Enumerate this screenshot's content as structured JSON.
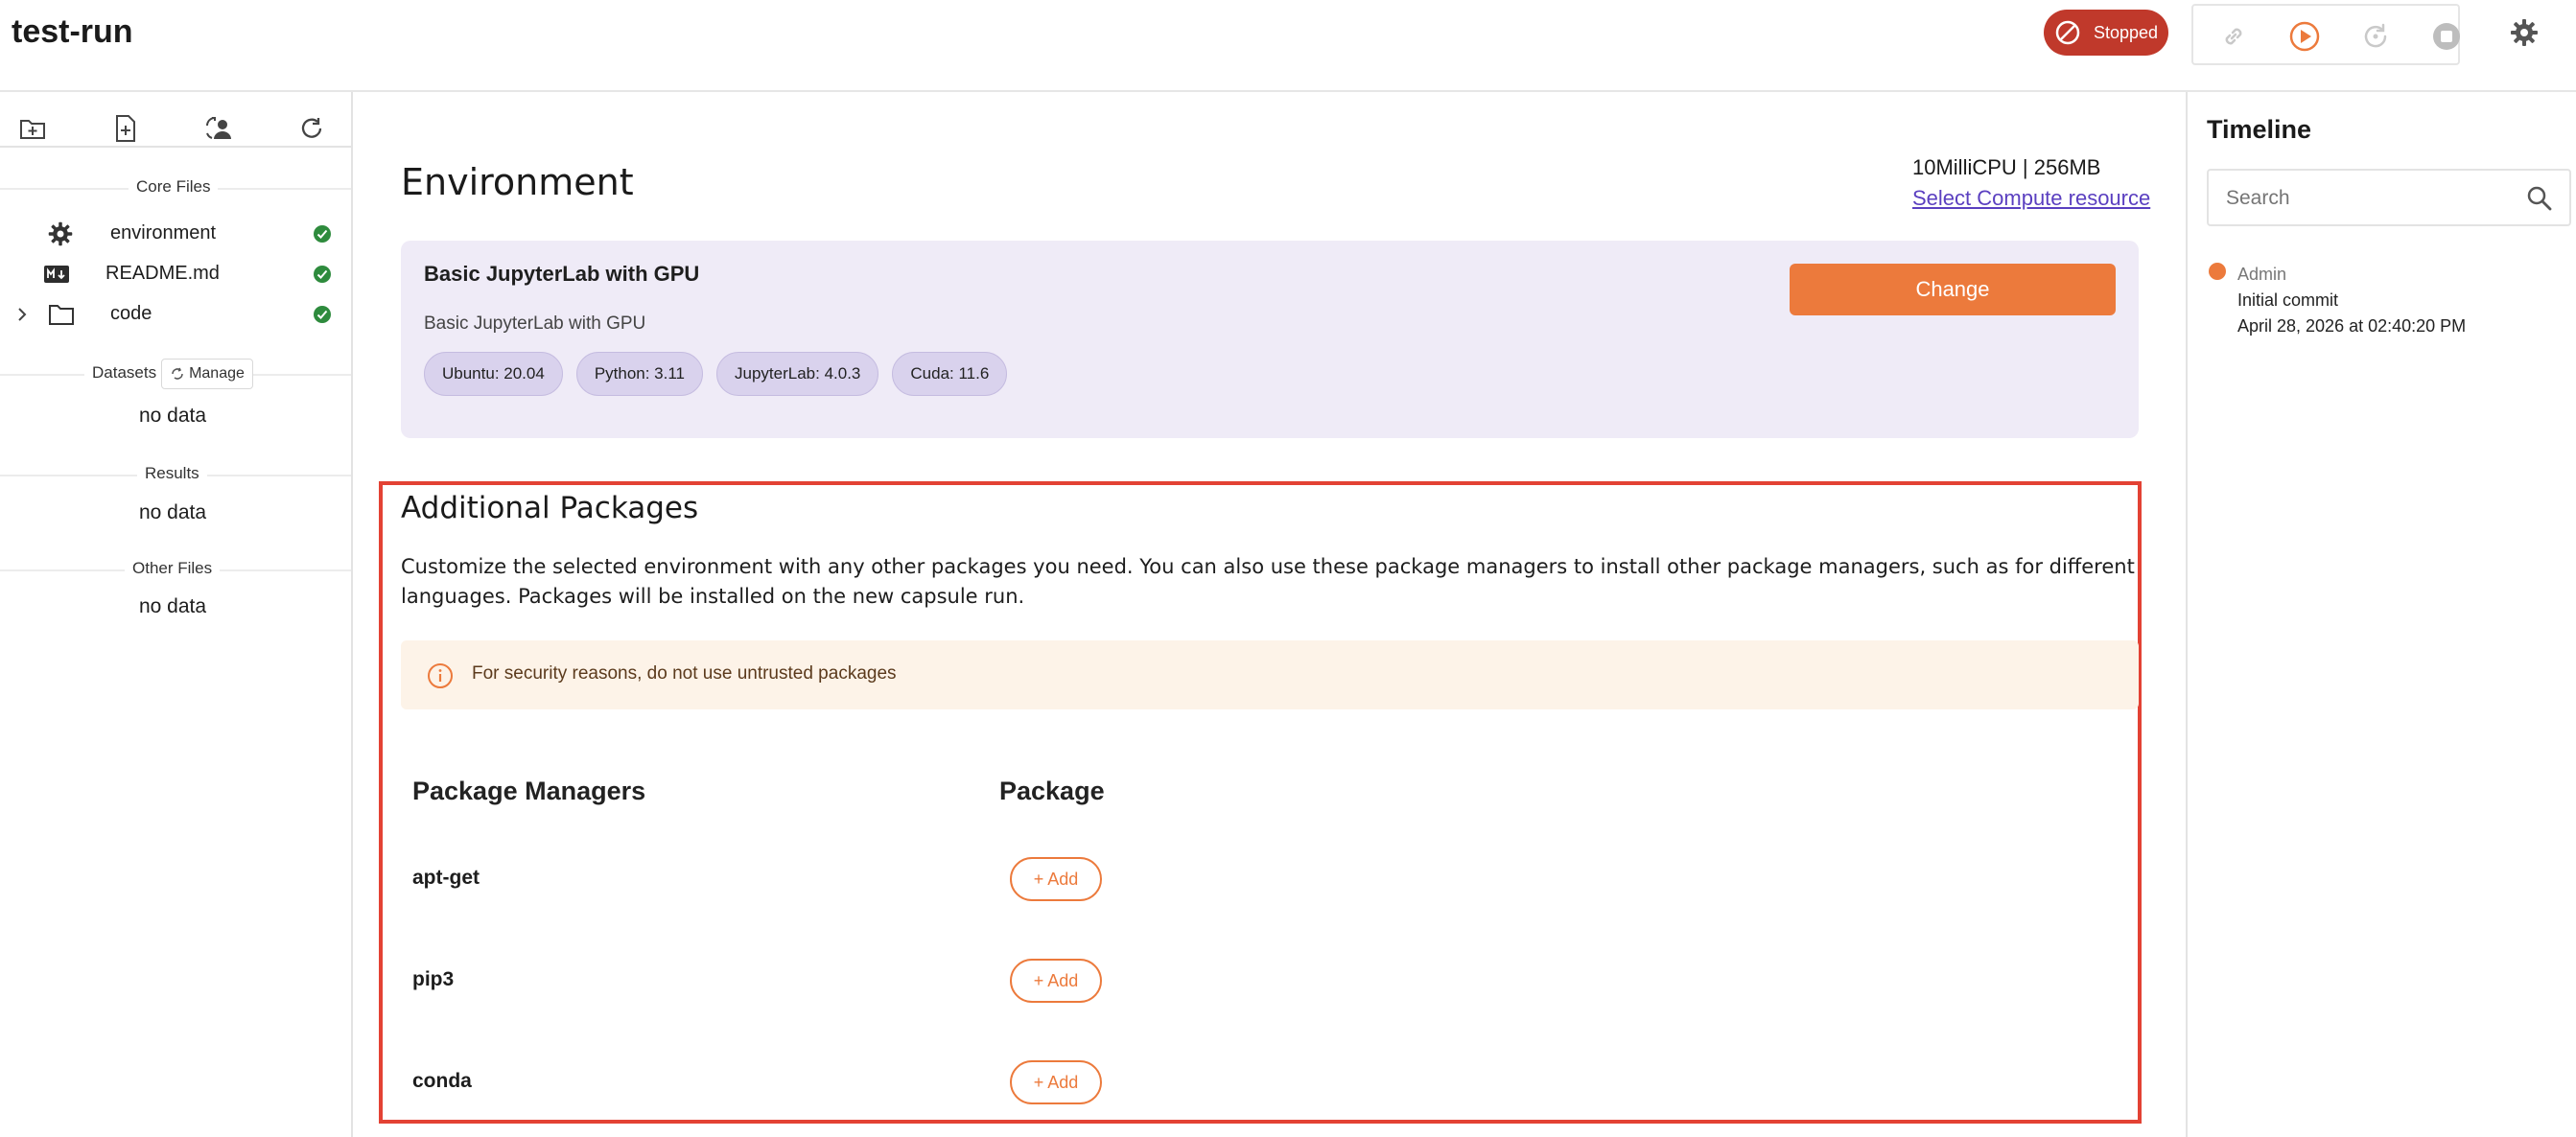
{
  "app": {
    "title": "test-run"
  },
  "header": {
    "status": "Stopped",
    "colors": {
      "status_bg": "#c0392b",
      "accent": "#ec7a3c"
    },
    "tools": [
      "link-icon",
      "play-icon",
      "restart-icon",
      "stop-icon"
    ],
    "settings_icon": "gear-icon"
  },
  "sidebar": {
    "tools": [
      "new-folder-icon",
      "new-file-icon",
      "switch-user-icon",
      "refresh-icon"
    ],
    "core_files_label": "Core Files",
    "files": [
      {
        "name": "environment",
        "icon": "gear-icon",
        "status": "check-icon"
      },
      {
        "name": "README.md",
        "icon": "markdown-icon",
        "status": "check-icon"
      },
      {
        "name": "code",
        "icon": "folder-icon",
        "status": "check-icon"
      }
    ],
    "datasets_label": "Datasets",
    "manage_label": "Manage",
    "datasets_empty": "no data",
    "results_label": "Results",
    "results_empty": "no data",
    "other_files_label": "Other Files",
    "other_files_empty": "no data"
  },
  "main": {
    "title": "Environment",
    "compute": "10MilliCPU | 256MB",
    "compute_link": "Select Compute resource",
    "env": {
      "name": "Basic JupyterLab with GPU",
      "description": "Basic JupyterLab with GPU",
      "tags": [
        "Ubuntu: 20.04",
        "Python: 3.11",
        "JupyterLab: 4.0.3",
        "Cuda: 11.6"
      ],
      "change_label": "Change"
    },
    "additional": {
      "title": "Additional Packages",
      "description": "Customize the selected environment with any other packages you need. You can also use these package managers to install other package managers, such as for different languages. Packages will be installed on the new capsule run.",
      "warning": "For security reasons, do not use untrusted packages",
      "col_managers": "Package Managers",
      "col_package": "Package",
      "managers": [
        {
          "name": "apt-get",
          "add_label": "+ Add"
        },
        {
          "name": "pip3",
          "add_label": "+ Add"
        },
        {
          "name": "conda",
          "add_label": "+ Add"
        }
      ]
    }
  },
  "timeline": {
    "title": "Timeline",
    "search_placeholder": "Search",
    "entries": [
      {
        "user": "Admin",
        "message": "Initial commit",
        "date": "April 28, 2026 at 02:40:20 PM"
      }
    ]
  }
}
